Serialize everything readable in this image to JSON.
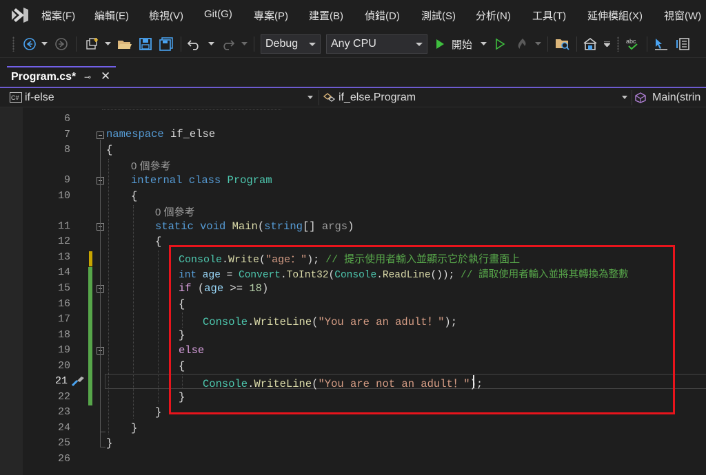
{
  "menu": {
    "items": [
      {
        "label": "檔案(F)"
      },
      {
        "label": "編輯(E)"
      },
      {
        "label": "檢視(V)"
      },
      {
        "label": "Git(G)"
      },
      {
        "label": "專案(P)"
      },
      {
        "label": "建置(B)"
      },
      {
        "label": "偵錯(D)"
      },
      {
        "label": "測試(S)"
      },
      {
        "label": "分析(N)"
      },
      {
        "label": "工具(T)"
      },
      {
        "label": "延伸模組(X)"
      },
      {
        "label": "視窗(W)"
      }
    ]
  },
  "toolbar": {
    "configuration": "Debug",
    "platform": "Any CPU",
    "start_label": "開始"
  },
  "tab": {
    "title": "Program.cs*"
  },
  "navbar": {
    "project": "if-else",
    "type": "if_else.Program",
    "member": "Main(strin"
  },
  "editor": {
    "line_numbers": [
      "6",
      "7",
      "8",
      "",
      "9",
      "10",
      "",
      "11",
      "12",
      "13",
      "14",
      "15",
      "16",
      "17",
      "18",
      "19",
      "20",
      "21",
      "22",
      "23",
      "24",
      "25",
      "26"
    ],
    "current_line": "21",
    "code_lens": {
      "class_refs": "0 個參考",
      "method_refs": "0 個參考"
    },
    "lines": {
      "l7_kw": "namespace",
      "l7_id": " if_else",
      "l8": "{",
      "l9_kw1": "internal",
      "l9_kw2": " class",
      "l9_ty": " Program",
      "l10": "{",
      "l11_kw1": "static",
      "l11_kw2": " void",
      "l11_me": " Main",
      "l11_p1": "(",
      "l11_kw3": "string",
      "l11_p2": "[] ",
      "l11_id": "args",
      "l11_p3": ")",
      "l12": "{",
      "l13_ty": "Console",
      "l13_p1": ".",
      "l13_me": "Write",
      "l13_p2": "(",
      "l13_st": "\"age：\"",
      "l13_p3": "); ",
      "l13_cm": "// 提示使用者輸入並顯示它於執行畫面上",
      "l14_kw": "int",
      "l14_id": " age",
      "l14_p1": " = ",
      "l14_ty": "Convert",
      "l14_p2": ".",
      "l14_me": "ToInt32",
      "l14_p3": "(",
      "l14_ty2": "Console",
      "l14_p4": ".",
      "l14_me2": "ReadLine",
      "l14_p5": "()); ",
      "l14_cm": "// 讀取使用者輸入並將其轉換為整數",
      "l15_ctl": "if",
      "l15_p1": " (",
      "l15_id": "age",
      "l15_p2": " >= ",
      "l15_nu": "18",
      "l15_p3": ")",
      "l16": "{",
      "l17_ty": "Console",
      "l17_p1": ".",
      "l17_me": "WriteLine",
      "l17_p2": "(",
      "l17_st": "\"You are an adult！\"",
      "l17_p3": ");",
      "l18": "}",
      "l19_ctl": "else",
      "l20": "{",
      "l21_ty": "Console",
      "l21_p1": ".",
      "l21_me": "WriteLine",
      "l21_p2": "(",
      "l21_st": "\"You are not an adult！\"",
      "l21_p3": ");",
      "l22": "}",
      "l23": "}",
      "l24": "}",
      "l25": "}"
    }
  },
  "colors": {
    "accent": "#6d5bd0",
    "highlight_box": "#e8141c",
    "change_bar": "#57a64a",
    "editor_bg": "#1e1e1e"
  }
}
